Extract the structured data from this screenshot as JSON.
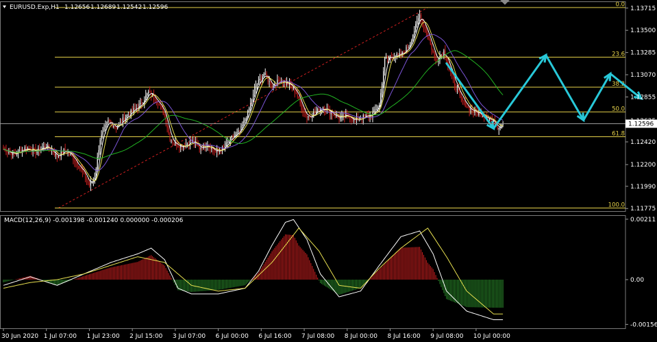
{
  "chart_data": [
    {
      "type": "candlestick",
      "title": "EURUSD.Exp,H1",
      "ohlc": [
        "1.12656",
        "1.12689",
        "1.12542",
        "1.12596"
      ],
      "current_price": 1.12596,
      "current_price_label": "1.12596",
      "y_ticks": [
        1.13715,
        1.135,
        1.13285,
        1.1307,
        1.12855,
        1.12625,
        1.1242,
        1.122,
        1.1199,
        1.11775
      ],
      "y_tick_labels": [
        "1.13715",
        "1.13500",
        "1.13285",
        "1.13070",
        "1.12855",
        "1.12625",
        "1.12420",
        "1.12200",
        "1.11990",
        "1.11775"
      ],
      "ylim": [
        1.1175,
        1.1378
      ],
      "x_labels": [
        "30 Jun 2020",
        "1 Jul 07:00",
        "1 Jul 23:00",
        "2 Jul 15:00",
        "3 Jul 07:00",
        "6 Jul 00:00",
        "6 Jul 16:00",
        "7 Jul 08:00",
        "8 Jul 00:00",
        "8 Jul 16:00",
        "9 Jul 08:00",
        "10 Jul 00:00"
      ],
      "close_path": [
        [
          0,
          1.1235
        ],
        [
          8,
          1.123
        ],
        [
          16,
          1.1236
        ],
        [
          24,
          1.1233
        ],
        [
          32,
          1.1238
        ],
        [
          40,
          1.1228
        ],
        [
          46,
          1.1234
        ],
        [
          52,
          1.1226
        ],
        [
          58,
          1.1215
        ],
        [
          64,
          1.12
        ],
        [
          68,
          1.1208
        ],
        [
          72,
          1.1245
        ],
        [
          78,
          1.1262
        ],
        [
          84,
          1.1256
        ],
        [
          90,
          1.1265
        ],
        [
          96,
          1.1272
        ],
        [
          102,
          1.1278
        ],
        [
          108,
          1.129
        ],
        [
          114,
          1.1283
        ],
        [
          120,
          1.1268
        ],
        [
          124,
          1.1245
        ],
        [
          128,
          1.124
        ],
        [
          134,
          1.1238
        ],
        [
          140,
          1.1243
        ],
        [
          146,
          1.1236
        ],
        [
          152,
          1.124
        ],
        [
          158,
          1.1232
        ],
        [
          164,
          1.1236
        ],
        [
          170,
          1.1246
        ],
        [
          176,
          1.1252
        ],
        [
          182,
          1.127
        ],
        [
          188,
          1.1296
        ],
        [
          194,
          1.1308
        ],
        [
          200,
          1.1296
        ],
        [
          206,
          1.1302
        ],
        [
          212,
          1.1298
        ],
        [
          218,
          1.129
        ],
        [
          222,
          1.1275
        ],
        [
          226,
          1.1266
        ],
        [
          232,
          1.127
        ],
        [
          238,
          1.1276
        ],
        [
          244,
          1.127
        ],
        [
          250,
          1.1265
        ],
        [
          256,
          1.1267
        ],
        [
          262,
          1.1263
        ],
        [
          268,
          1.1266
        ],
        [
          274,
          1.1268
        ],
        [
          280,
          1.1278
        ],
        [
          284,
          1.1322
        ],
        [
          290,
          1.1325
        ],
        [
          296,
          1.1326
        ],
        [
          302,
          1.1335
        ],
        [
          306,
          1.135
        ],
        [
          310,
          1.1365
        ],
        [
          316,
          1.1345
        ],
        [
          322,
          1.132
        ],
        [
          328,
          1.133
        ],
        [
          334,
          1.1305
        ],
        [
          340,
          1.1285
        ],
        [
          346,
          1.1275
        ],
        [
          352,
          1.127
        ],
        [
          358,
          1.1268
        ],
        [
          364,
          1.1262
        ],
        [
          368,
          1.1256
        ],
        [
          372,
          1.126
        ]
      ],
      "fibonacci": {
        "levels": [
          {
            "label": "0.0",
            "value": 1.1372
          },
          {
            "label": "23.6",
            "value": 1.1324
          },
          {
            "label": "38.2",
            "value": 1.1295
          },
          {
            "label": "50.0",
            "value": 1.1271
          },
          {
            "label": "61.8",
            "value": 1.1247
          },
          {
            "label": "100.0",
            "value": 1.1178
          }
        ],
        "anchor_from": [
          41,
          1.1178
        ],
        "anchor_to": [
          316,
          1.1372
        ]
      },
      "projection_path": [
        [
          330,
          1.1318
        ],
        [
          365,
          1.1255
        ],
        [
          404,
          1.1326
        ],
        [
          432,
          1.1263
        ],
        [
          452,
          1.1308
        ],
        [
          475,
          1.1284
        ]
      ],
      "colors": {
        "bull": "#ffffff",
        "bear": "#cc1f1f",
        "fib": "#e6d24a",
        "ma_white": "#ffffff",
        "ma_yellow": "#e8e050",
        "ma_purple": "#7c55d8",
        "ma_green": "#22b322",
        "projection": "#28c8d8",
        "trend": "#d42020"
      }
    },
    {
      "type": "macd",
      "label": "MACD(12,26,9) -0.001398 -0.001240 0.000000 -0.000206",
      "y_tick_labels": [
        "0.00211",
        "0.00",
        "-0.001565"
      ],
      "ylim": [
        -0.0017,
        0.00225
      ],
      "macd_path": [
        [
          0,
          -0.0002
        ],
        [
          20,
          0.0001
        ],
        [
          40,
          -0.0002
        ],
        [
          60,
          0.0002
        ],
        [
          80,
          0.0006
        ],
        [
          100,
          0.0009
        ],
        [
          110,
          0.0011
        ],
        [
          120,
          0.0007
        ],
        [
          130,
          -0.0003
        ],
        [
          140,
          -0.0005
        ],
        [
          160,
          -0.0005
        ],
        [
          180,
          -0.0003
        ],
        [
          190,
          0.0003
        ],
        [
          200,
          0.0012
        ],
        [
          210,
          0.002
        ],
        [
          216,
          0.0021
        ],
        [
          226,
          0.0014
        ],
        [
          236,
          0.0002
        ],
        [
          250,
          -0.0006
        ],
        [
          266,
          -0.0004
        ],
        [
          280,
          0.0005
        ],
        [
          296,
          0.0015
        ],
        [
          310,
          0.0017
        ],
        [
          320,
          0.0009
        ],
        [
          330,
          -0.0004
        ],
        [
          345,
          -0.0011
        ],
        [
          365,
          -0.0014
        ]
      ],
      "signal_path": [
        [
          0,
          -0.0003
        ],
        [
          20,
          -0.0001
        ],
        [
          40,
          0.0
        ],
        [
          60,
          0.0002
        ],
        [
          80,
          0.0005
        ],
        [
          100,
          0.0008
        ],
        [
          120,
          0.0006
        ],
        [
          140,
          -0.0002
        ],
        [
          160,
          -0.0004
        ],
        [
          180,
          -0.0003
        ],
        [
          200,
          0.0006
        ],
        [
          220,
          0.0018
        ],
        [
          235,
          0.001
        ],
        [
          250,
          -0.0002
        ],
        [
          266,
          -0.0003
        ],
        [
          280,
          0.0004
        ],
        [
          296,
          0.0011
        ],
        [
          316,
          0.0018
        ],
        [
          330,
          0.0008
        ],
        [
          345,
          -0.0004
        ],
        [
          365,
          -0.0012
        ]
      ],
      "colors": {
        "hist_pos": "#d02020",
        "hist_neg": "#2a8a2a",
        "macd": "#ffffff",
        "signal": "#e8e050"
      }
    }
  ]
}
